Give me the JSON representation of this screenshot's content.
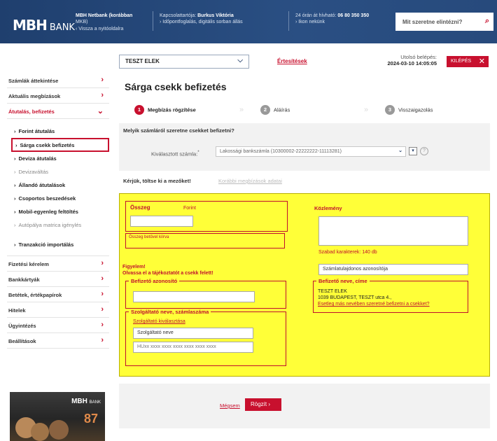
{
  "header": {
    "logo_mark": "MBH",
    "logo_text": "BANK",
    "netbank_line1": "MBH Netbank (korábban",
    "netbank_line2": "MKB)",
    "back_link": "‹ Vissza a nyitóoldalra",
    "contact_label": "Kapcsolattartója:",
    "contact_name": "Burkus Viktória",
    "appointment": "› Időpontfoglalás, digitális sorban állás",
    "phone_label": "24 órán át hívható:",
    "phone": "06 80 350 350",
    "for_you": "› Ikon nekünk",
    "search_placeholder": "Mit szeretne elintézni?"
  },
  "userbar": {
    "user": "TESZT ELEK",
    "notifications": "Értesítések",
    "last_login_label": "Utolsó belépés:",
    "last_login_value": "2024-03-10 14:05:05",
    "logout": "KILÉPÉS"
  },
  "sidebar": {
    "items_top": [
      "Számlák áttekintése",
      "Aktuális megbízások"
    ],
    "open_item": "Átutalás, befizetés",
    "sub": [
      {
        "label": "Forint átutalás",
        "style": "normal"
      },
      {
        "label": "Sárga csekk befizetés",
        "style": "active"
      },
      {
        "label": "Deviza átutalás",
        "style": "normal"
      },
      {
        "label": "Devizaváltás",
        "style": "muted"
      },
      {
        "label": "Állandó átutalások",
        "style": "normal"
      },
      {
        "label": "Csoportos beszedések",
        "style": "normal"
      },
      {
        "label": "Mobil-egyenleg feltöltés",
        "style": "normal"
      },
      {
        "label": "Autópálya matrica igénylés",
        "style": "muted"
      },
      {
        "label": "Tranzakció importálás",
        "style": "normal"
      }
    ],
    "items_bottom": [
      "Fizetési kérelem",
      "Bankkártyák",
      "Betétek, értékpapírok",
      "Hitelek",
      "Ügyintézés",
      "Beállítások"
    ],
    "promo_logo": "MBH",
    "promo_sub": "BANK",
    "promo_number": "87"
  },
  "main": {
    "title": "Sárga csekk befizetés",
    "steps": [
      {
        "num": "1",
        "label": "Megbízás rögzítése"
      },
      {
        "num": "2",
        "label": "Aláírás"
      },
      {
        "num": "3",
        "label": "Visszaigazolás"
      }
    ],
    "account_question": "Melyik számláról szeretne csekket befizetni?",
    "account_label": "Kiválasztott számla:",
    "account_value": "Lakossági bankszámla (10300002-22222222-11113281)",
    "help": "?",
    "fill_prompt": "Kérjük, töltse ki a mezőket!",
    "previous_data": "Korábbi megbízások adatai"
  },
  "check": {
    "amount_label": "Összeg",
    "amount_unit": "Forint",
    "amount_value": "",
    "amount_words_label": "Összeg betűvel kiírva",
    "remark_label": "Közlemény",
    "free_chars": "Szabad karakterek: 140 db",
    "warning_line1": "Figyelem!",
    "warning_line2": "Olvassa el a tájékoztatót a csekk felett!",
    "payer_id_label": "Befizető azonosító",
    "account_holder_placeholder": "Számlatulajdonos azonosítója",
    "payer_name_label": "Befizető neve, címe",
    "payer_name": "TESZT ELEK",
    "payer_address": "1039 BUDAPEST, TESZT utca 4.,",
    "payer_other_link": "Esetleg más nevében szeretné befizetni a csekket?",
    "provider_label": "Szolgáltató neve, számlaszáma",
    "provider_select_link": "Szolgáltató kiválasztása",
    "provider_name_placeholder": "Szolgáltató neve",
    "provider_account_placeholder": "HUxx xxxx xxxx xxxx xxxx xxxx xxxx"
  },
  "actions": {
    "cancel": "Mégsem",
    "save": "Rögzít"
  },
  "colors": {
    "brand_red": "#c8102e",
    "header_blue": "#1f3f6e",
    "check_yellow": "#ffff38"
  }
}
